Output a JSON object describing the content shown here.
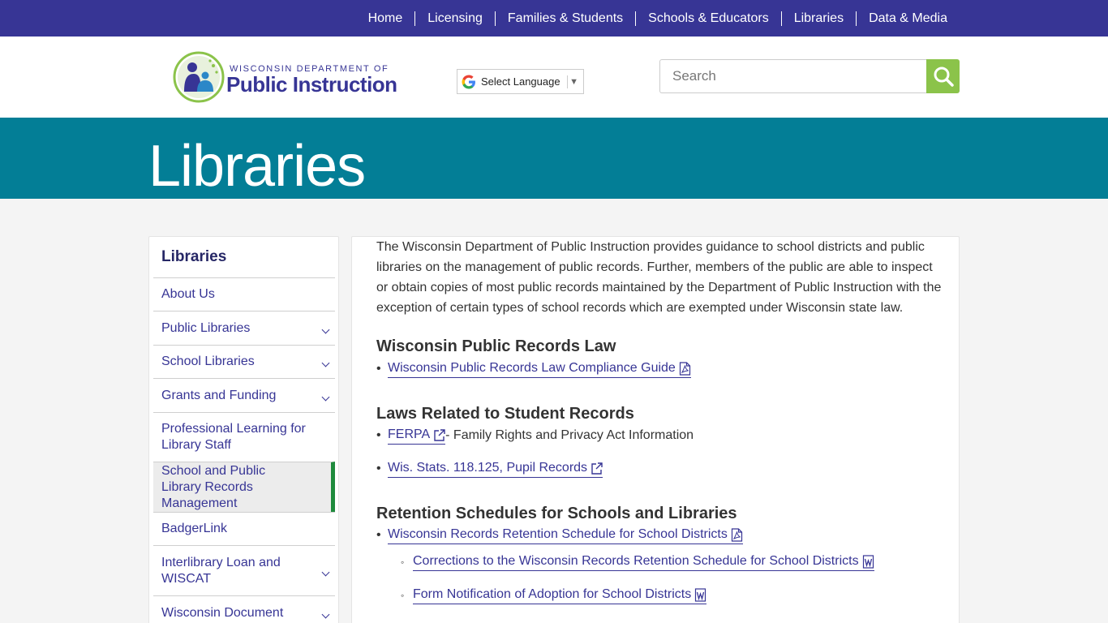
{
  "nav": {
    "items": [
      "Home",
      "Licensing",
      "Families & Students",
      "Schools & Educators",
      "Libraries",
      "Data & Media"
    ]
  },
  "header": {
    "logo_small": "WISCONSIN DEPARTMENT OF",
    "logo_big": "Public Instruction",
    "language_label": "Select Language",
    "search_placeholder": "Search"
  },
  "banner": {
    "title": "Libraries"
  },
  "sidebar": {
    "title": "Libraries",
    "items": [
      {
        "label": "About Us",
        "expandable": false
      },
      {
        "label": "Public Libraries",
        "expandable": true
      },
      {
        "label": "School Libraries",
        "expandable": true
      },
      {
        "label": "Grants and Funding",
        "expandable": true
      },
      {
        "label": "Professional Learning for Library Staff",
        "expandable": false
      },
      {
        "label": "School and Public Library Records Management",
        "expandable": false,
        "active": true
      },
      {
        "label": "BadgerLink",
        "expandable": false
      },
      {
        "label": "Interlibrary Loan and WISCAT",
        "expandable": true
      },
      {
        "label": "Wisconsin Document",
        "expandable": true
      }
    ]
  },
  "main": {
    "intro": "The Wisconsin Department of Public Instruction provides guidance to school districts and public libraries on the management of public records. Further, members of the public are able to inspect or obtain copies of most public records maintained by the Department of Public Instruction with the exception of certain types of school records which are exempted under Wisconsin state law.",
    "section1": {
      "heading": "Wisconsin Public Records Law",
      "link1": "Wisconsin Public Records Law Compliance Guide"
    },
    "section2": {
      "heading": "Laws Related to Student Records",
      "link1": "FERPA",
      "link1_suffix": " - Family Rights and Privacy Act Information",
      "link2": "Wis. Stats. 118.125, Pupil Records"
    },
    "section3": {
      "heading": "Retention Schedules for Schools and Libraries",
      "link1": "Wisconsin Records Retention Schedule for School Districts",
      "sub1": "Corrections to the Wisconsin Records Retention Schedule for School Districts",
      "sub2": "Form Notification of Adoption for School Districts"
    }
  }
}
